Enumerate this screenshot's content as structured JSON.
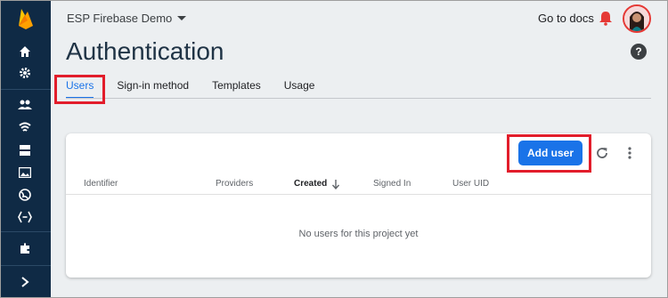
{
  "header": {
    "project_name": "ESP Firebase Demo",
    "docs_link": "Go to docs"
  },
  "page": {
    "title": "Authentication",
    "help": "?"
  },
  "tabs": [
    {
      "label": "Users",
      "active": true
    },
    {
      "label": "Sign-in method",
      "active": false
    },
    {
      "label": "Templates",
      "active": false
    },
    {
      "label": "Usage",
      "active": false
    }
  ],
  "users_panel": {
    "add_user_label": "Add user",
    "columns": [
      "Identifier",
      "Providers",
      "Created",
      "Signed In",
      "User UID"
    ],
    "sorted_column": "Created",
    "empty_message": "No users for this project yet"
  },
  "sidebar": {
    "icons": [
      "home-icon",
      "gear-icon",
      "people-icon",
      "wifi-icon",
      "storage-icon",
      "image-icon",
      "globe-icon",
      "functions-icon",
      "extensions-icon",
      "chevron-right-icon"
    ]
  },
  "colors": {
    "sidebar": "#0f2a45",
    "accent": "#1a73e8",
    "highlight": "#e21d2b",
    "logo": "#ffa000"
  }
}
